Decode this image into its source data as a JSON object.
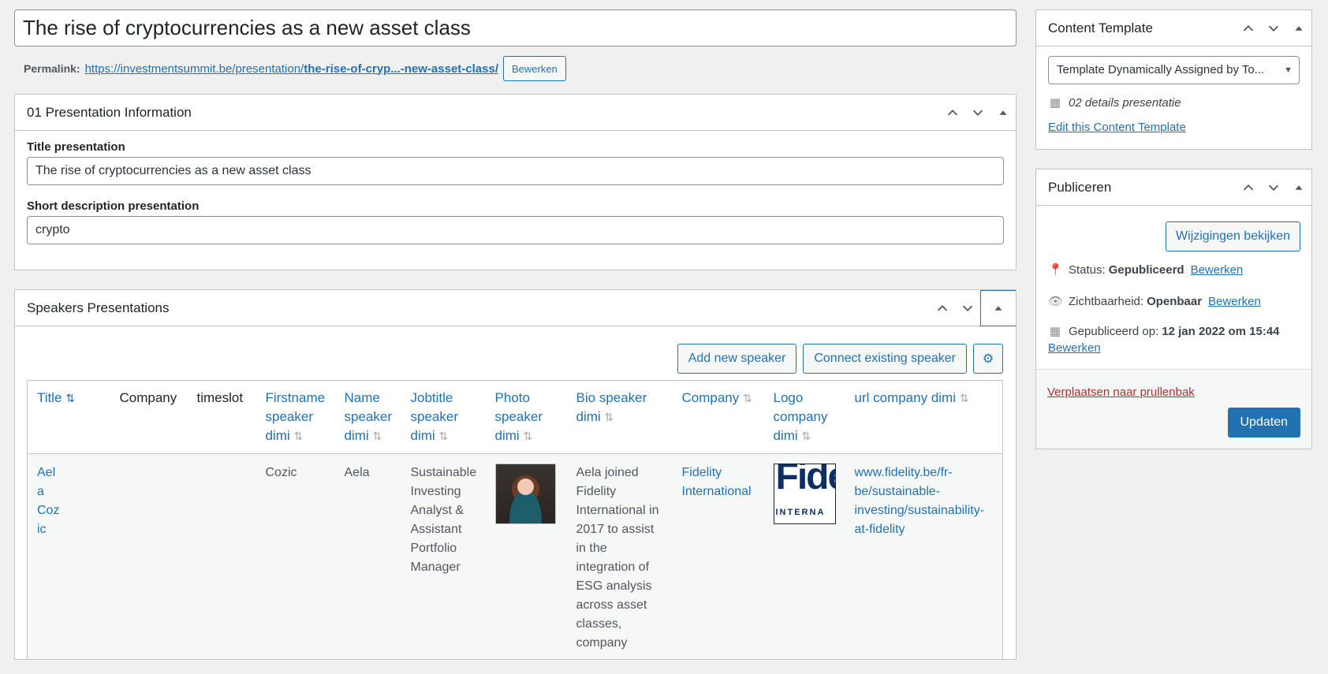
{
  "post": {
    "title": "The rise of cryptocurrencies as a new asset class",
    "permalink_label": "Permalink:",
    "permalink_base": "https://investmentsummit.be/presentation/",
    "permalink_slug": "the-rise-of-cryp...-new-asset-class/",
    "permalink_edit": "Bewerken"
  },
  "presentation_box": {
    "title": "01 Presentation Information",
    "fields": [
      {
        "label": "Title presentation",
        "value": "The rise of cryptocurrencies as a new asset class"
      },
      {
        "label": "Short description presentation",
        "value": "crypto"
      }
    ]
  },
  "speakers_box": {
    "title": "Speakers Presentations",
    "buttons": {
      "add": "Add new speaker",
      "connect": "Connect existing speaker"
    },
    "columns": [
      "Title",
      "Company",
      "timeslot",
      "Firstname speaker dimi",
      "Name speaker dimi",
      "Jobtitle speaker dimi",
      "Photo speaker dimi",
      "Bio speaker dimi",
      "Company",
      "Logo company dimi",
      "url company dimi"
    ],
    "row": {
      "title": "Ael a Cozic",
      "company": "",
      "timeslot": "",
      "firstname": "Cozic",
      "name": "Aela",
      "jobtitle": "Sustainable Investing Analyst & Assistant Portfolio Manager",
      "bio": "Aela joined Fidelity International in 2017 to assist in the integration of ESG analysis across asset classes, company",
      "company2": "Fidelity International",
      "logo_text": "Fide",
      "logo_sub": "INTERNA",
      "url": "www.fidelity.be/fr-be/sustainable-investing/sustainability-at-fidelity"
    }
  },
  "template_box": {
    "title": "Content Template",
    "selected": "Template Dynamically Assigned by To...",
    "details": "02 details presentatie",
    "edit_link": "Edit this Content Template"
  },
  "publish_box": {
    "title": "Publiceren",
    "preview": "Wijzigingen bekijken",
    "status_label": "Status:",
    "status_value": "Gepubliceerd",
    "visibility_label": "Zichtbaarheid:",
    "visibility_value": "Openbaar",
    "published_label": "Gepubliceerd op:",
    "published_value": "12 jan 2022 om 15:44",
    "edit": "Bewerken",
    "trash": "Verplaatsen naar prullenbak",
    "update": "Updaten"
  }
}
